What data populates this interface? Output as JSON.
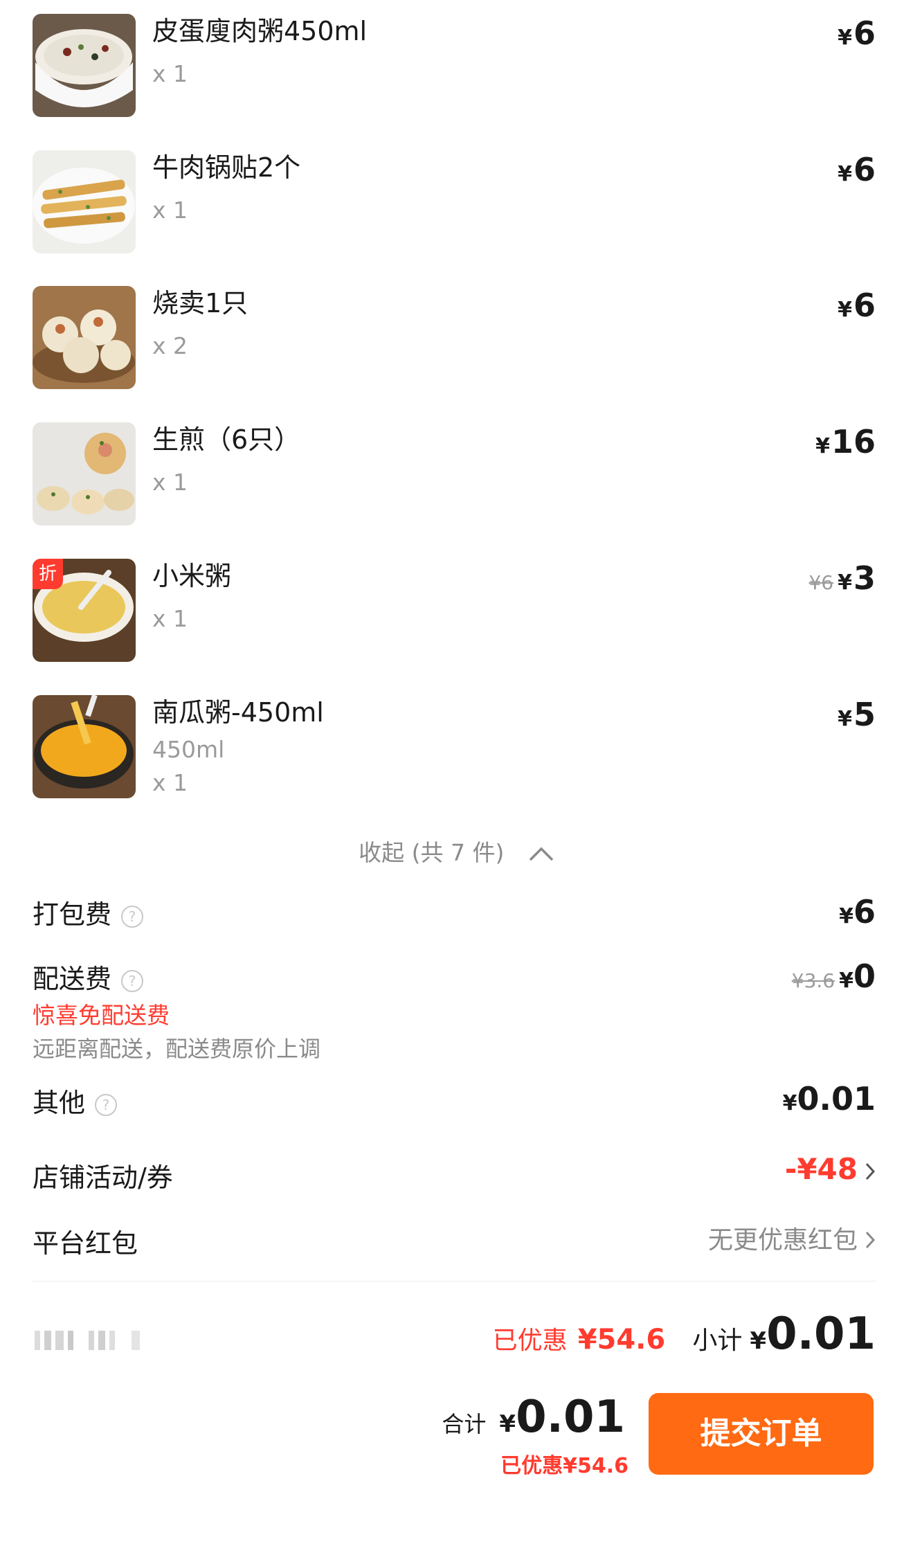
{
  "currency": "¥",
  "items": [
    {
      "name": "皮蛋廋肉粥450ml",
      "qty": "x 1",
      "price": "6",
      "image": "congee-bowl"
    },
    {
      "name": "牛肉锅贴2个",
      "qty": "x 1",
      "price": "6",
      "image": "potstickers"
    },
    {
      "name": "烧卖1只",
      "qty": "x 2",
      "price": "6",
      "image": "shaomai"
    },
    {
      "name": "生煎（6只）",
      "qty": "x 1",
      "price": "16",
      "image": "pan-fried-buns"
    },
    {
      "name": "小米粥",
      "qty": "x 1",
      "price": "3",
      "original_price": "¥6",
      "badge": "折",
      "image": "millet-congee"
    },
    {
      "name": "南瓜粥-450ml",
      "spec": "450ml",
      "qty": "x 1",
      "price": "5",
      "image": "pumpkin-congee"
    }
  ],
  "collapse_label": "收起 (共 7 件)",
  "fees": {
    "packing": {
      "label": "打包费",
      "value": "6"
    },
    "delivery": {
      "label": "配送费",
      "original": "¥3.6",
      "value": "0",
      "promo": "惊喜免配送费",
      "note": "远距离配送，配送费原价上调"
    },
    "other": {
      "label": "其他",
      "value": "0.01"
    },
    "store_coupon": {
      "label": "店铺活动/券",
      "value": "-¥48"
    },
    "platform_redpacket": {
      "label": "平台红包",
      "value": "无更优惠红包"
    }
  },
  "summary": {
    "discount_label": "已优惠",
    "discount_value": "¥54.6",
    "subtotal_label": "小计",
    "subtotal_value": "0.01"
  },
  "footer": {
    "total_label": "合计",
    "total_value": "0.01",
    "discount_text": "已优惠¥54.6",
    "submit_label": "提交订单"
  },
  "colors": {
    "accent": "#ff6a13",
    "promo_red": "#ff3b2f"
  }
}
